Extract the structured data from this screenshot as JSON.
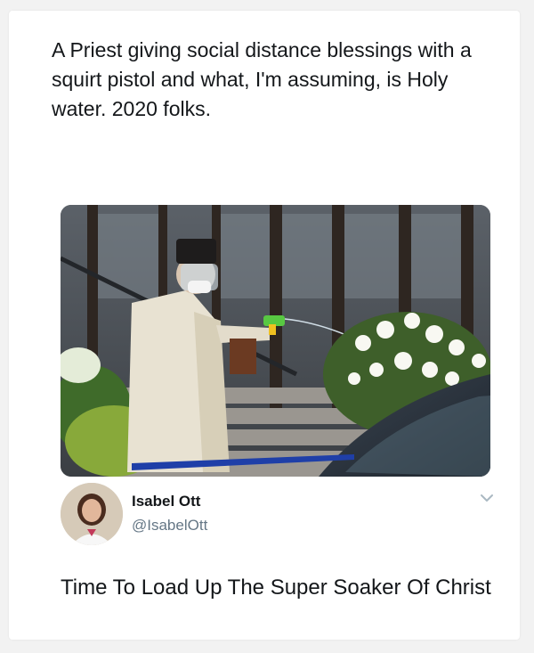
{
  "quote_text": "A Priest giving social distance blessings with a squirt pistol and what, I'm assuming, is Holy water. 2020 folks.",
  "tweet": {
    "author_name": "Isabel Ott",
    "author_handle": "@IsabelOtt",
    "text": "Time To Load Up The Super Soaker Of Christ"
  },
  "icons": {
    "more_menu": "chevron-down-icon"
  },
  "colors": {
    "text_primary": "#14171a",
    "text_secondary": "#657786",
    "background": "#ffffff"
  }
}
